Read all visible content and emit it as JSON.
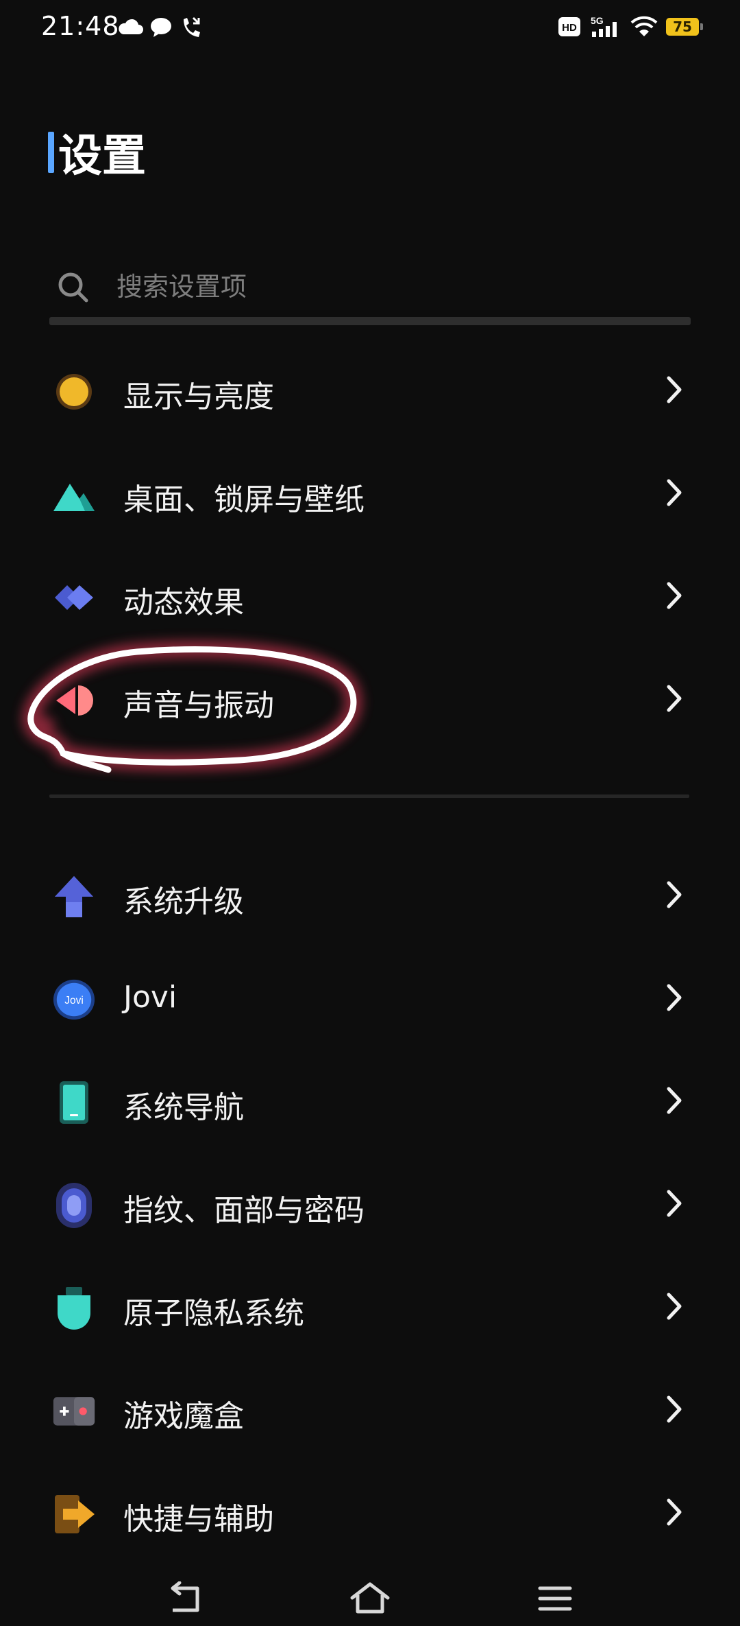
{
  "status_bar": {
    "time": "21:48",
    "left_icons": [
      "cloud-icon",
      "chat-bubble-icon",
      "missed-call-icon"
    ],
    "right_icons": [
      "hd-icon",
      "5g-signal-icon",
      "wifi-icon",
      "battery-icon"
    ],
    "network_label": "5G",
    "hd_label": "HD",
    "battery_level": "75",
    "battery_color": "#f1c21b"
  },
  "header": {
    "title": "设置",
    "accent_color": "#5aa6ff"
  },
  "search": {
    "placeholder": "搜索设置项",
    "icon": "search-icon"
  },
  "section_one": [
    {
      "label": "显示与亮度",
      "icon": "sun-icon",
      "color": "#f0b82a"
    },
    {
      "label": "桌面、锁屏与壁纸",
      "icon": "mountain-icon",
      "color": "#3fd8c8"
    },
    {
      "label": "动态效果",
      "icon": "diamond-icon",
      "color": "#6b7df0"
    },
    {
      "label": "声音与振动",
      "icon": "speaker-icon",
      "color": "#ff6b7a"
    }
  ],
  "section_two": [
    {
      "label": "系统升级",
      "icon": "up-arrow-icon",
      "color": "#6f7ff0"
    },
    {
      "label": "Jovi",
      "icon": "jovi-icon",
      "color": "#3b7ef5",
      "badge": "Jovi"
    },
    {
      "label": "系统导航",
      "icon": "phone-icon",
      "color": "#3fd8c8"
    },
    {
      "label": "指纹、面部与密码",
      "icon": "fingerprint-icon",
      "color": "#6b7df0"
    },
    {
      "label": "原子隐私系统",
      "icon": "privacy-shield-icon",
      "color": "#3fd8c8"
    },
    {
      "label": "游戏魔盒",
      "icon": "game-box-icon",
      "color": "#5a5a66"
    },
    {
      "label": "快捷与辅助",
      "icon": "shortcut-arrow-icon",
      "color": "#f0a82a"
    }
  ],
  "annotation": {
    "shape": "hand-drawn-circle",
    "target": "声音与振动",
    "color": "#ffffff"
  },
  "nav_bar": {
    "buttons": [
      "back-icon",
      "home-icon",
      "menu-icon"
    ]
  }
}
